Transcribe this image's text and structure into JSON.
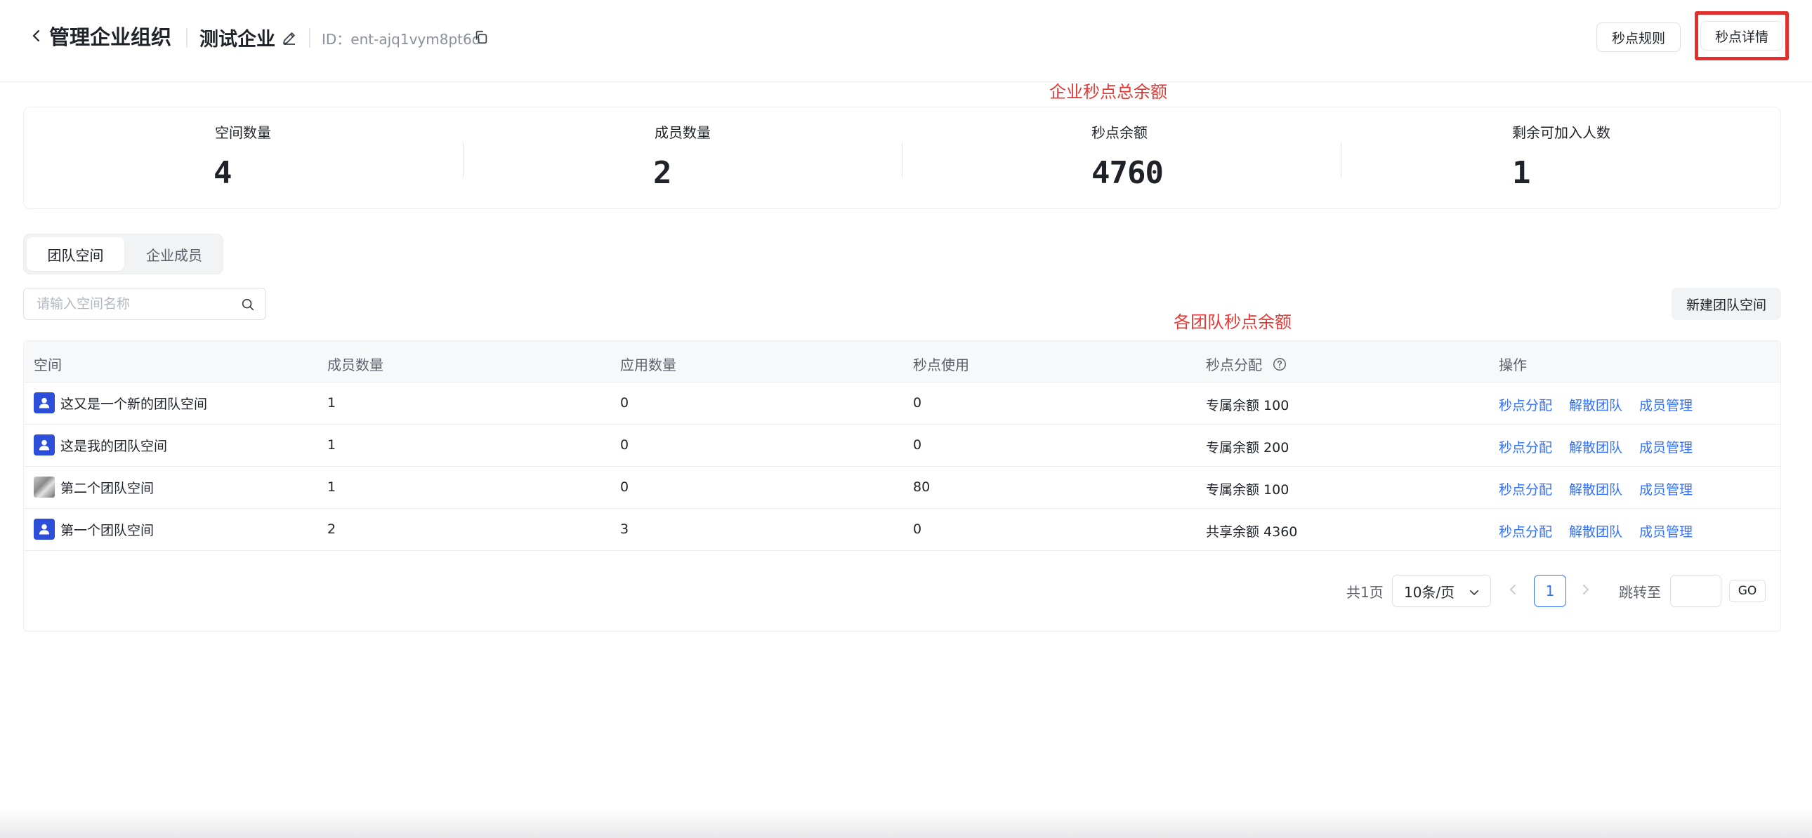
{
  "header": {
    "back_label": "管理企业组织",
    "enterprise_name": "测试企业",
    "enterprise_id": "ID：ent-ajq1vym8pt6o",
    "rules_button": "秒点规则",
    "detail_button": "秒点详情"
  },
  "annotations": {
    "total_balance": "企业秒点总余额",
    "team_balance": "各团队秒点余额",
    "highlight_color": "#e0312f"
  },
  "stats": [
    {
      "label": "空间数量",
      "value": "4"
    },
    {
      "label": "成员数量",
      "value": "2"
    },
    {
      "label": "秒点余额",
      "value": "4760"
    },
    {
      "label": "剩余可加入人数",
      "value": "1"
    }
  ],
  "tabs": [
    {
      "label": "团队空间",
      "active": true
    },
    {
      "label": "企业成员",
      "active": false
    }
  ],
  "search": {
    "placeholder": "请输入空间名称"
  },
  "new_space_button": "新建团队空间",
  "table": {
    "columns": [
      "空间",
      "成员数量",
      "应用数量",
      "秒点使用",
      "秒点分配",
      "操作"
    ],
    "rows": [
      {
        "name": "这又是一个新的团队空间",
        "members": "1",
        "apps": "0",
        "usage": "0",
        "allocation": "专属余额 100",
        "avatar": "user-icon"
      },
      {
        "name": "这是我的团队空间",
        "members": "1",
        "apps": "0",
        "usage": "0",
        "allocation": "专属余额 200",
        "avatar": "user-icon"
      },
      {
        "name": "第二个团队空间",
        "members": "1",
        "apps": "0",
        "usage": "80",
        "allocation": "专属余额 100",
        "avatar": "photo"
      },
      {
        "name": "第一个团队空间",
        "members": "2",
        "apps": "3",
        "usage": "0",
        "allocation": "共享余额 4360",
        "avatar": "user-icon"
      }
    ],
    "actions": [
      "秒点分配",
      "解散团队",
      "成员管理"
    ]
  },
  "pagination": {
    "total_text": "共1页",
    "page_size": "10条/页",
    "current_page": "1",
    "jump_label": "跳转至",
    "go_label": "GO"
  },
  "colors": {
    "link": "#3370ff",
    "avatar": "#2d4ed8",
    "annotation": "#e53935"
  }
}
